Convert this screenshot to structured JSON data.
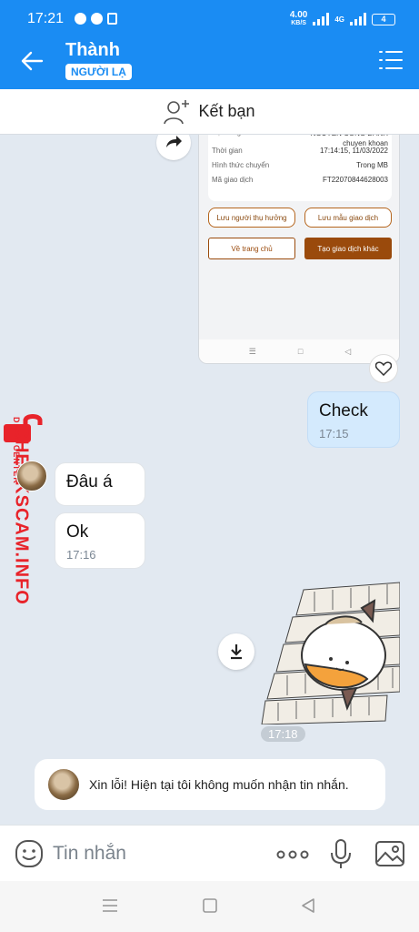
{
  "status_bar": {
    "time": "17:21",
    "net_speed": "4.00",
    "net_unit": "KB/S",
    "network_type": "4G",
    "battery": "4"
  },
  "header": {
    "title": "Thành",
    "badge": "NGƯỜI LẠ",
    "accent_color": "#1a8cf3"
  },
  "add_friend": {
    "label": "Kết bạn"
  },
  "shared_screenshot": {
    "rows": [
      {
        "label": "Nội dung",
        "value": "NGUYEN CONG DANH chuyen khoan"
      },
      {
        "label": "Thời gian",
        "value": "17:14:15, 11/03/2022"
      },
      {
        "label": "Hình thức chuyển",
        "value": "Trong MB"
      },
      {
        "label": "Mã giao dịch",
        "value": "FT22070844628003"
      }
    ],
    "save_recipient": "Lưu người thụ hưởng",
    "save_template": "Lưu mẫu giao dịch",
    "home_button": "Về trang chủ",
    "new_transaction_button": "Tạo giao dịch khác",
    "button_color": "#9a4a0c"
  },
  "watermark": {
    "brand": "CHECKSCAM.INFO",
    "sub": "DATA CENTER",
    "color": "#e8232a"
  },
  "messages": [
    {
      "id": "check",
      "direction": "out",
      "text": "Check",
      "time": "17:15"
    },
    {
      "id": "dau-a",
      "direction": "in",
      "text": "Đâu á",
      "time": ""
    },
    {
      "id": "ok",
      "direction": "in",
      "text": "Ok",
      "time": "17:16"
    }
  ],
  "sticker": {
    "time": "17:18"
  },
  "system_message": {
    "text": "Xin lỗi! Hiện tại tôi không muốn nhận tin nhắn."
  },
  "composer": {
    "placeholder": "Tin nhắn"
  }
}
